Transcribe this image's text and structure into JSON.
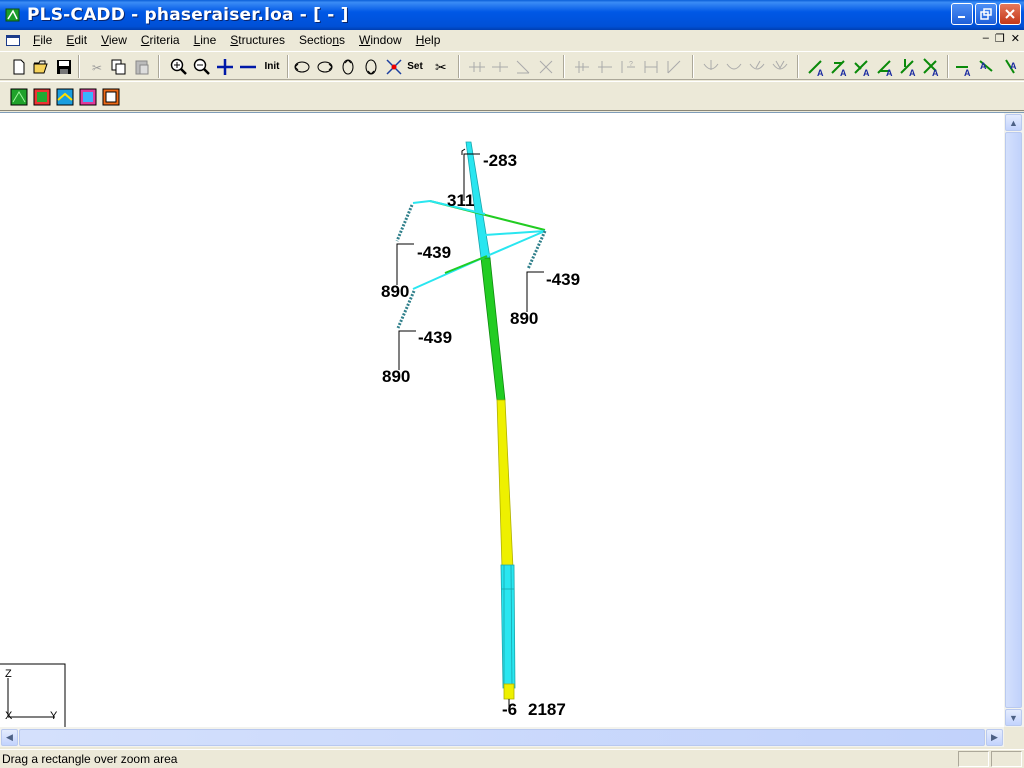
{
  "window": {
    "title": "PLS-CADD - phaseraiser.loa - [ - ]"
  },
  "menu": {
    "items": [
      {
        "u": "F",
        "rest": "ile"
      },
      {
        "u": "E",
        "rest": "dit"
      },
      {
        "u": "V",
        "rest": "iew"
      },
      {
        "u": "C",
        "rest": "riteria"
      },
      {
        "u": "L",
        "rest": "ine"
      },
      {
        "u": "S",
        "rest": "tructures"
      },
      {
        "pre": "Sectio",
        "u": "n",
        "rest": "s"
      },
      {
        "u": "W",
        "rest": "indow"
      },
      {
        "u": "H",
        "rest": "elp"
      }
    ]
  },
  "toolbar": {
    "init_label": "Init",
    "set_label": "Set"
  },
  "axes": {
    "z": "Z",
    "x": "X",
    "y": "Y"
  },
  "labels": {
    "top_a": "-283",
    "top_b": "311",
    "left_upper_a": "-439",
    "left_upper_b": "890",
    "right_a": "-439",
    "right_b": "890",
    "left_lower_a": "-439",
    "left_lower_b": "890",
    "base_a": "-6",
    "base_b": "2187"
  },
  "status": {
    "text": "Drag a rectangle over zoom area"
  }
}
